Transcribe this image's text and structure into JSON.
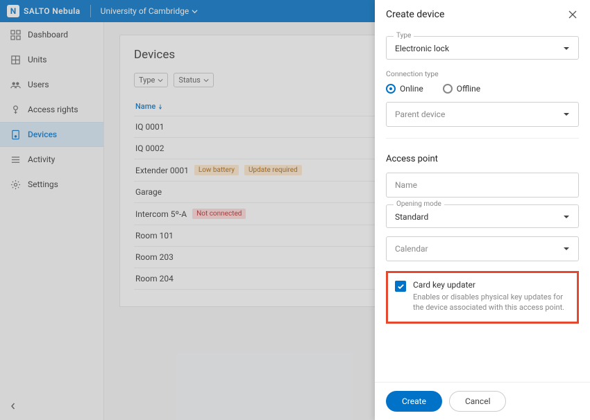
{
  "brand": {
    "logo_letter": "N",
    "name": "SALTO Nebula"
  },
  "tenant": {
    "name": "University of Cambridge"
  },
  "sidebar": {
    "items": [
      {
        "label": "Dashboard"
      },
      {
        "label": "Units"
      },
      {
        "label": "Users"
      },
      {
        "label": "Access rights"
      },
      {
        "label": "Devices"
      },
      {
        "label": "Activity"
      },
      {
        "label": "Settings"
      }
    ]
  },
  "page": {
    "title": "Devices",
    "filters": {
      "type": "Type",
      "status": "Status"
    },
    "col_name": "Name"
  },
  "rows": [
    {
      "name": "IQ 0001",
      "badges": []
    },
    {
      "name": "IQ 0002",
      "badges": []
    },
    {
      "name": "Extender 0001",
      "badges": [
        {
          "t": "Low battery",
          "k": "warn"
        },
        {
          "t": "Update required",
          "k": "warn"
        }
      ]
    },
    {
      "name": "Garage",
      "badges": []
    },
    {
      "name": "Intercom 5º-A",
      "badges": [
        {
          "t": "Not connected",
          "k": "err"
        }
      ]
    },
    {
      "name": "Room 101",
      "badges": []
    },
    {
      "name": "Room 203",
      "badges": []
    },
    {
      "name": "Room 204",
      "badges": []
    }
  ],
  "panel": {
    "title": "Create device",
    "type_label": "Type",
    "type_value": "Electronic lock",
    "conn_label": "Connection type",
    "conn_online": "Online",
    "conn_offline": "Offline",
    "parent_placeholder": "Parent device",
    "section_access": "Access point",
    "name_placeholder": "Name",
    "opening_label": "Opening mode",
    "opening_value": "Standard",
    "calendar_placeholder": "Calendar",
    "cku_title": "Card key updater",
    "cku_desc": "Enables or disables physical key updates for the device associated with this access point.",
    "create": "Create",
    "cancel": "Cancel"
  }
}
